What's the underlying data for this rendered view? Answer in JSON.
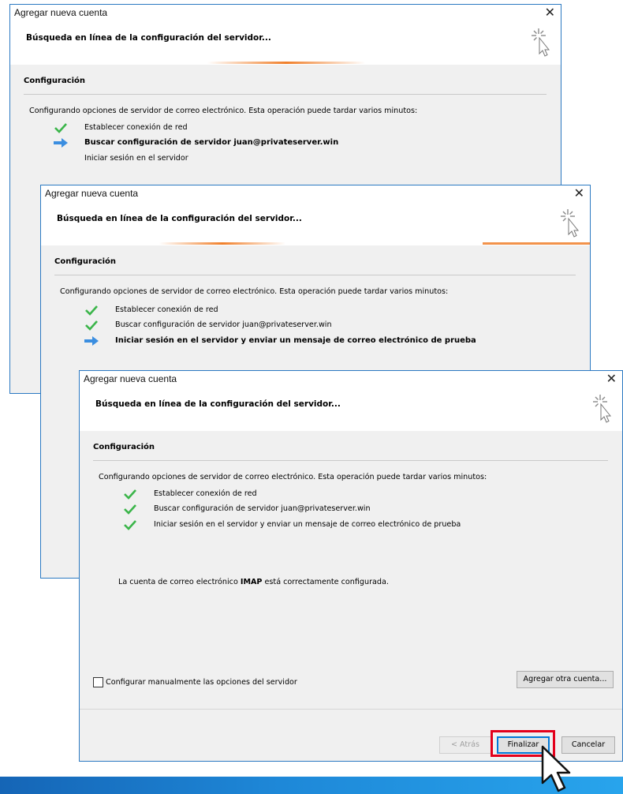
{
  "windows": [
    {
      "title": "Agregar nueva cuenta",
      "header": "Búsqueda en línea de la configuración del servidor...",
      "section": "Configuración",
      "intro": "Configurando opciones de servidor de correo electrónico. Esta operación puede tardar varios minutos:",
      "steps": [
        {
          "label": "Establecer conexión de red",
          "state": "done"
        },
        {
          "label": "Buscar configuración de servidor juan@privateserver.win",
          "state": "current"
        },
        {
          "label": "Iniciar sesión en el servidor",
          "state": "pending"
        }
      ]
    },
    {
      "title": "Agregar nueva cuenta",
      "header": "Búsqueda en línea de la configuración del servidor...",
      "section": "Configuración",
      "intro": "Configurando opciones de servidor de correo electrónico. Esta operación puede tardar varios minutos:",
      "steps": [
        {
          "label": "Establecer conexión de red",
          "state": "done"
        },
        {
          "label": "Buscar configuración de servidor juan@privateserver.win",
          "state": "done"
        },
        {
          "label": "Iniciar sesión en el servidor y enviar un mensaje de correo electrónico de prueba",
          "state": "current"
        }
      ]
    },
    {
      "title": "Agregar nueva cuenta",
      "header": "Búsqueda en línea de la configuración del servidor...",
      "section": "Configuración",
      "intro": "Configurando opciones de servidor de correo electrónico. Esta operación puede tardar varios minutos:",
      "steps": [
        {
          "label": "Establecer conexión de red",
          "state": "done"
        },
        {
          "label": "Buscar configuración de servidor juan@privateserver.win",
          "state": "done"
        },
        {
          "label": "Iniciar sesión en el servidor y enviar un mensaje de correo electrónico de prueba",
          "state": "done"
        }
      ],
      "success_prefix": "La cuenta de correo electrónico",
      "success_protocol": "IMAP",
      "success_suffix": "está correctamente configurada.",
      "manual_checkbox_label": "Configurar manualmente las opciones del servidor",
      "manual_checkbox_checked": false,
      "add_another_label": "Agregar otra cuenta...",
      "back_label": "< Atrás",
      "finish_label": "Finalizar",
      "cancel_label": "Cancelar"
    }
  ],
  "icons": {
    "close": "close-icon",
    "spinner": "sparkle-cursor-icon",
    "done": "checkmark-icon",
    "current": "arrow-right-icon",
    "pointer": "mouse-pointer-icon"
  },
  "colors": {
    "window_border": "#2b79c2",
    "body_bg": "#f0f0f0",
    "check_green": "#3bb54a",
    "arrow_blue": "#3b8ee0",
    "progress_orange": "#f07f2a",
    "highlight_red": "#e3001b",
    "bottom_band": "#1e88d8"
  }
}
